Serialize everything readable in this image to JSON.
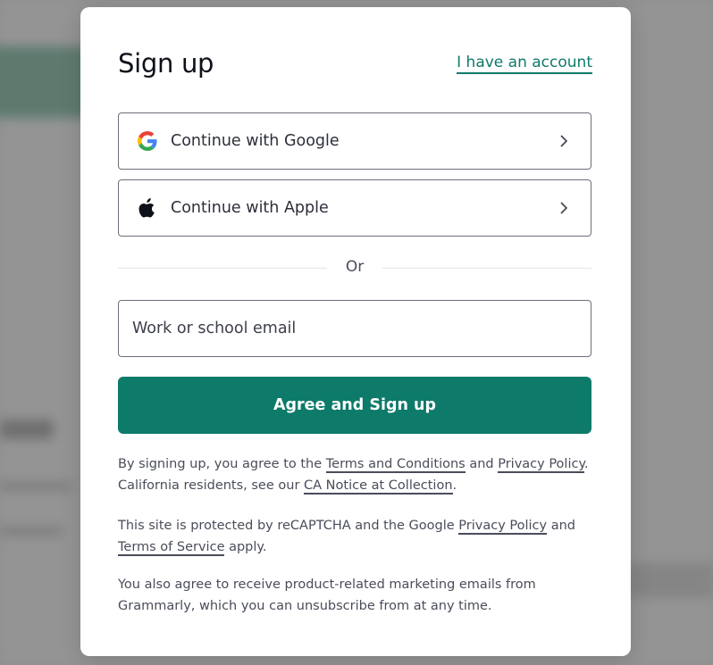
{
  "dialog": {
    "title": "Sign up",
    "account_link": "I have an account"
  },
  "oauth": {
    "google_label": "Continue with Google",
    "apple_label": "Continue with Apple",
    "google_icon": "google-g-icon",
    "apple_icon": "apple-logo-icon"
  },
  "divider": {
    "label": "Or"
  },
  "email": {
    "placeholder": "Work or school email",
    "value": ""
  },
  "submit": {
    "label": "Agree and Sign up"
  },
  "legal": {
    "p1_part1": "By signing up, you agree to the ",
    "terms_link": "Terms and Conditions",
    "p1_part2": " and ",
    "privacy_link": "Privacy Policy",
    "p1_part3": ". California residents, see our ",
    "ca_notice_link": "CA Notice at Collection",
    "p1_part4": ".",
    "p2_part1": "This site is protected by reCAPTCHA and the Google ",
    "google_privacy_link": "Privacy Policy",
    "p2_part2": " and ",
    "terms_service_link": "Terms of Service",
    "p2_part3": " apply.",
    "p3": "You also agree to receive product-related marketing emails from Grammarly, which you can unsubscribe from at any time."
  },
  "colors": {
    "accent": "#0d7a6a",
    "text": "#0e101a",
    "muted": "#4a4d5a",
    "border": "#6b6f7a",
    "overlay": "#8f8f8f"
  }
}
